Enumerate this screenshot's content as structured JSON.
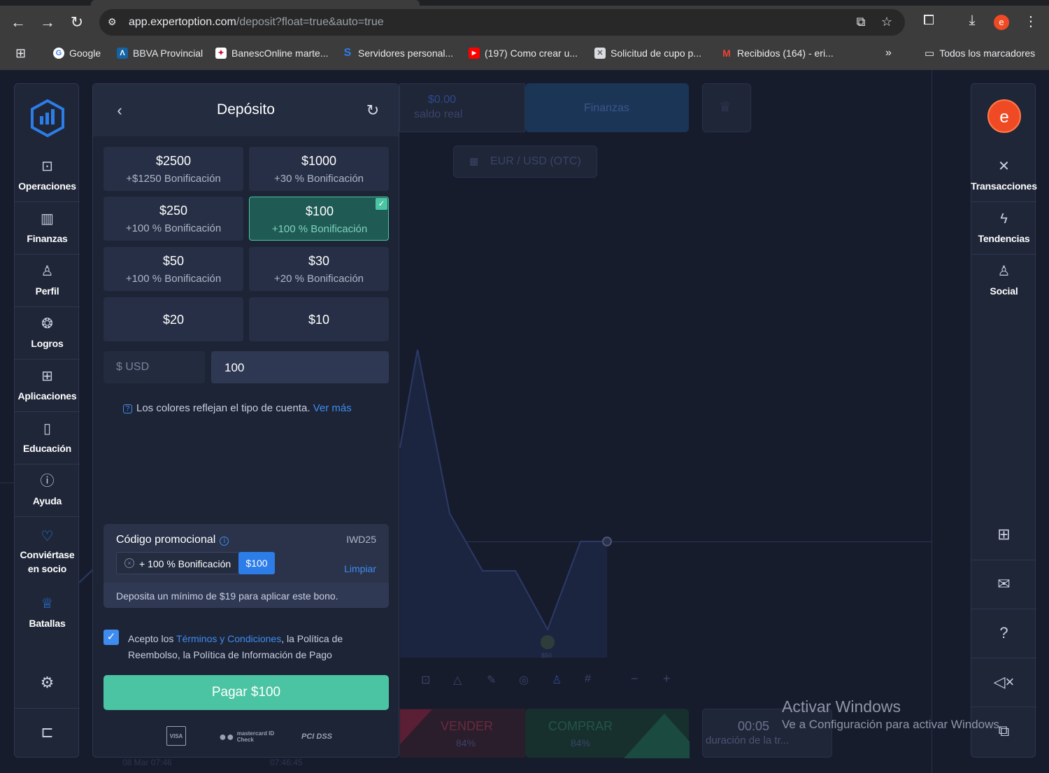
{
  "browser": {
    "url_host": "app.expertoption.com",
    "url_path": "/deposit?float=true&auto=true",
    "profile_initial": "e",
    "bookmarks": [
      {
        "label": "Google"
      },
      {
        "label": "BBVA Provincial"
      },
      {
        "label": "BanescOnline marte..."
      },
      {
        "label": "Servidores personal..."
      },
      {
        "label": "(197) Como crear u..."
      },
      {
        "label": "Solicitud de cupo p..."
      },
      {
        "label": "Recibidos (164) - eri..."
      }
    ],
    "all_bookmarks": "Todos los marcadores"
  },
  "leftnav": {
    "items": [
      {
        "label": "Operaciones",
        "icon": "chart-icon"
      },
      {
        "label": "Finanzas",
        "icon": "bank-icon"
      },
      {
        "label": "Perfil",
        "icon": "user-icon"
      },
      {
        "label": "Logros",
        "icon": "medal-icon"
      },
      {
        "label": "Aplicaciones",
        "icon": "apps-icon"
      },
      {
        "label": "Educación",
        "icon": "book-icon"
      },
      {
        "label": "Ayuda",
        "icon": "info-icon"
      },
      {
        "label1": "Conviértase",
        "label2": "en socio",
        "icon": "heart-icon"
      },
      {
        "label": "Batallas",
        "icon": "trophy-icon"
      }
    ]
  },
  "rightnav": {
    "avatar_initial": "e",
    "items": [
      {
        "label": "Transacciones",
        "icon": "transactions-icon"
      },
      {
        "label": "Tendencias",
        "icon": "lightning-icon"
      },
      {
        "label": "Social",
        "icon": "add-user-icon"
      }
    ]
  },
  "background": {
    "balance": "$0.00",
    "balance_label": "saldo real",
    "finance_tab": "Finanzas",
    "pair": "EUR / USD (OTC)",
    "sell_label": "VENDER",
    "sell_pct": "84%",
    "buy_label": "COMPRAR",
    "buy_pct": "84%",
    "duration": "00:05",
    "duration_label": "duración de la tr...",
    "marker_label": "$50",
    "time1": "08 Mar 07:46",
    "time2": "07:46:45"
  },
  "deposit": {
    "title": "Depósito",
    "packages": [
      {
        "amount": "$2500",
        "bonus": "+$1250 Bonificación"
      },
      {
        "amount": "$1000",
        "bonus": "+30 % Bonificación"
      },
      {
        "amount": "$250",
        "bonus": "+100 % Bonificación"
      },
      {
        "amount": "$100",
        "bonus": "+100 % Bonificación",
        "selected": true
      },
      {
        "amount": "$50",
        "bonus": "+100 % Bonificación"
      },
      {
        "amount": "$30",
        "bonus": "+20 % Bonificación"
      },
      {
        "amount": "$20"
      },
      {
        "amount": "$10"
      }
    ],
    "currency": "$ USD",
    "amount_value": "100",
    "info_text": "Los colores reflejan el tipo de cuenta.",
    "info_link": "Ver más",
    "promo": {
      "title": "Código promocional",
      "code": "IWD25",
      "chip_text": "+ 100 % Bonificación",
      "chip_value": "$100",
      "clear": "Limpiar",
      "footnote": "Deposita un mínimo de $19 para aplicar este bono."
    },
    "accept": {
      "pre": "Acepto los ",
      "link": "Términos y Condiciones",
      "post": ", la Política de Reembolso, la Política de Información de Pago"
    },
    "pay_button": "Pagar $100",
    "pay_logos": [
      "VISA",
      "mastercard ID Check",
      "PCI DSS"
    ]
  },
  "watermark": {
    "line1": "Activar Windows",
    "line2": "Ve a Configuración para activar Windows."
  }
}
